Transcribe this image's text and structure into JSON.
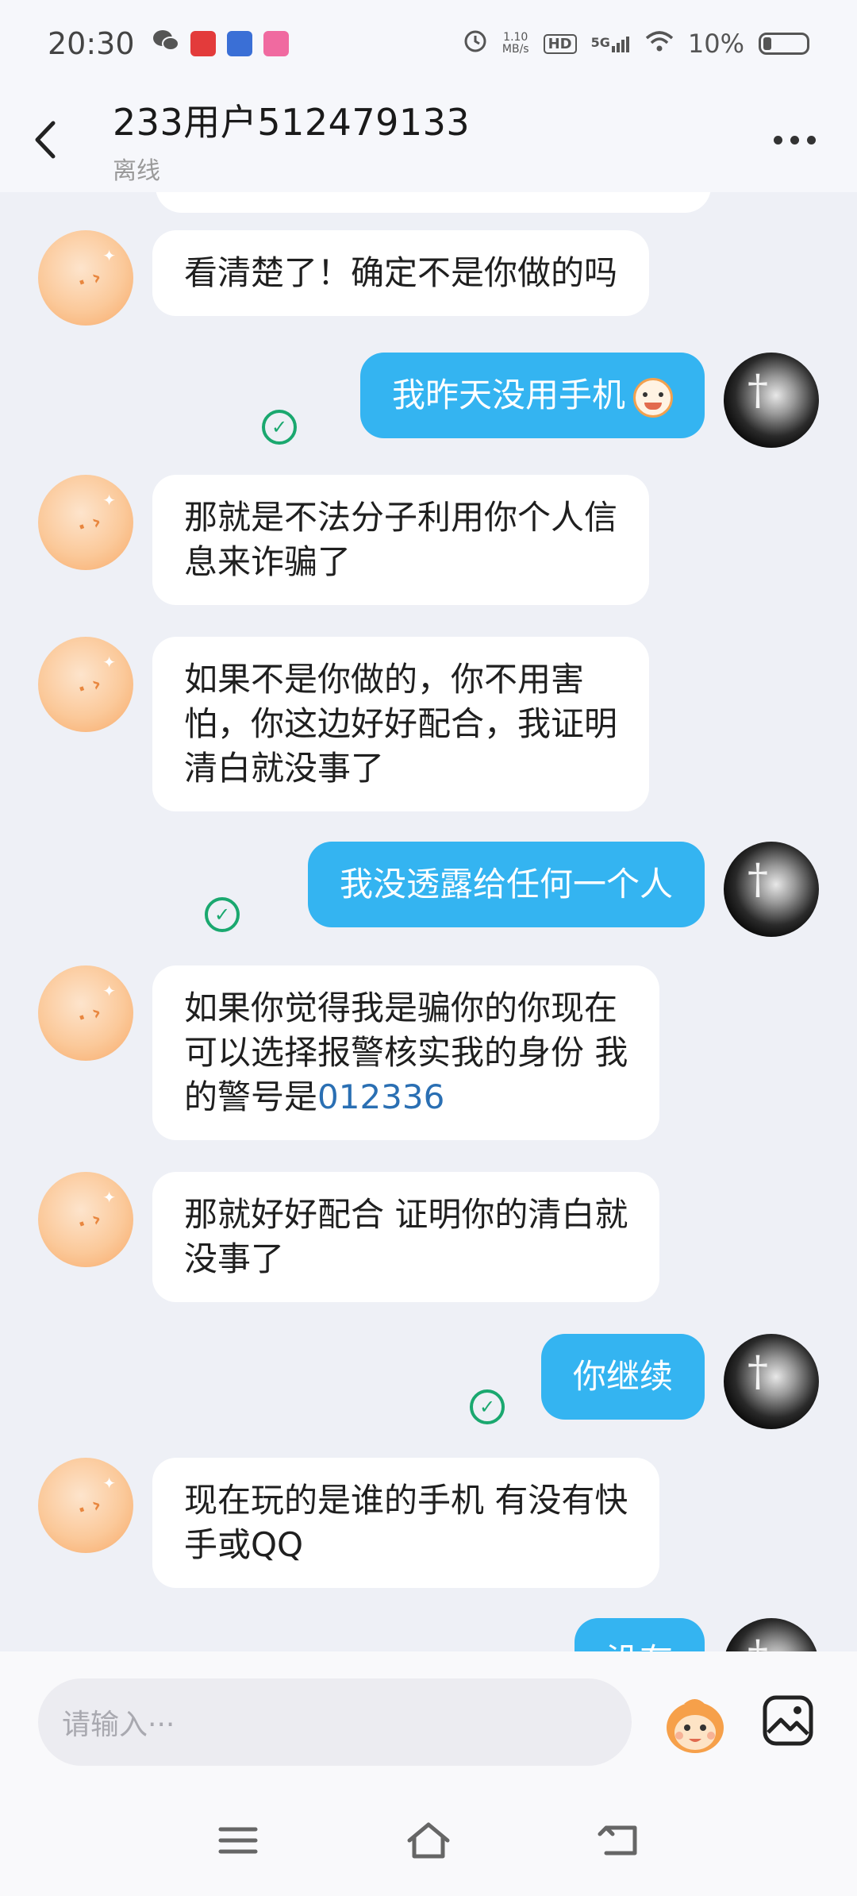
{
  "status_bar": {
    "time": "20:30",
    "net_speed_value": "1.10",
    "net_speed_unit": "MB/s",
    "hd_label": "HD",
    "network_label": "5G",
    "battery_text": "10%",
    "icons": [
      "wechat-icon",
      "app-icon-red",
      "app-icon-game",
      "app-icon-pink",
      "alarm-icon",
      "hd-icon",
      "signal-icon",
      "wifi-icon",
      "battery-icon"
    ]
  },
  "header": {
    "title": "233用户512479133",
    "subtitle": "离线"
  },
  "messages": [
    {
      "side": "left",
      "text": "看清楚了！确定不是你做的吗"
    },
    {
      "side": "right",
      "text": "我昨天没用手机",
      "emoji": "monkey-face-icon",
      "status": "sent-check-icon"
    },
    {
      "side": "left",
      "lines": [
        "那就是不法分子利用你个人信",
        "息来诈骗了"
      ]
    },
    {
      "side": "left",
      "lines": [
        "如果不是你做的，你不用害",
        "怕，你这边好好配合，我证明",
        "清白就没事了"
      ]
    },
    {
      "side": "right",
      "text": "我没透露给任何一个人",
      "status": "sent-check-icon"
    },
    {
      "side": "left",
      "lines": [
        "如果你觉得我是骗你的你现在",
        "可以选择报警核实我的身份 我"
      ],
      "line3_prefix": "的警号是",
      "link": "012336"
    },
    {
      "side": "left",
      "lines": [
        "那就好好配合 证明你的清白就",
        "没事了"
      ]
    },
    {
      "side": "right",
      "text": "你继续",
      "status": "sent-check-icon"
    },
    {
      "side": "left",
      "lines": [
        "现在玩的是谁的手机 有没有快",
        "手或QQ"
      ]
    },
    {
      "side": "right",
      "text": "没有",
      "partial": true
    }
  ],
  "input": {
    "placeholder": "请输入···"
  },
  "colors": {
    "sent_bubble": "#34b4f1",
    "received_bubble": "#ffffff",
    "background": "#eef0f6",
    "check": "#1aa86f",
    "link": "#2a6fb3"
  }
}
